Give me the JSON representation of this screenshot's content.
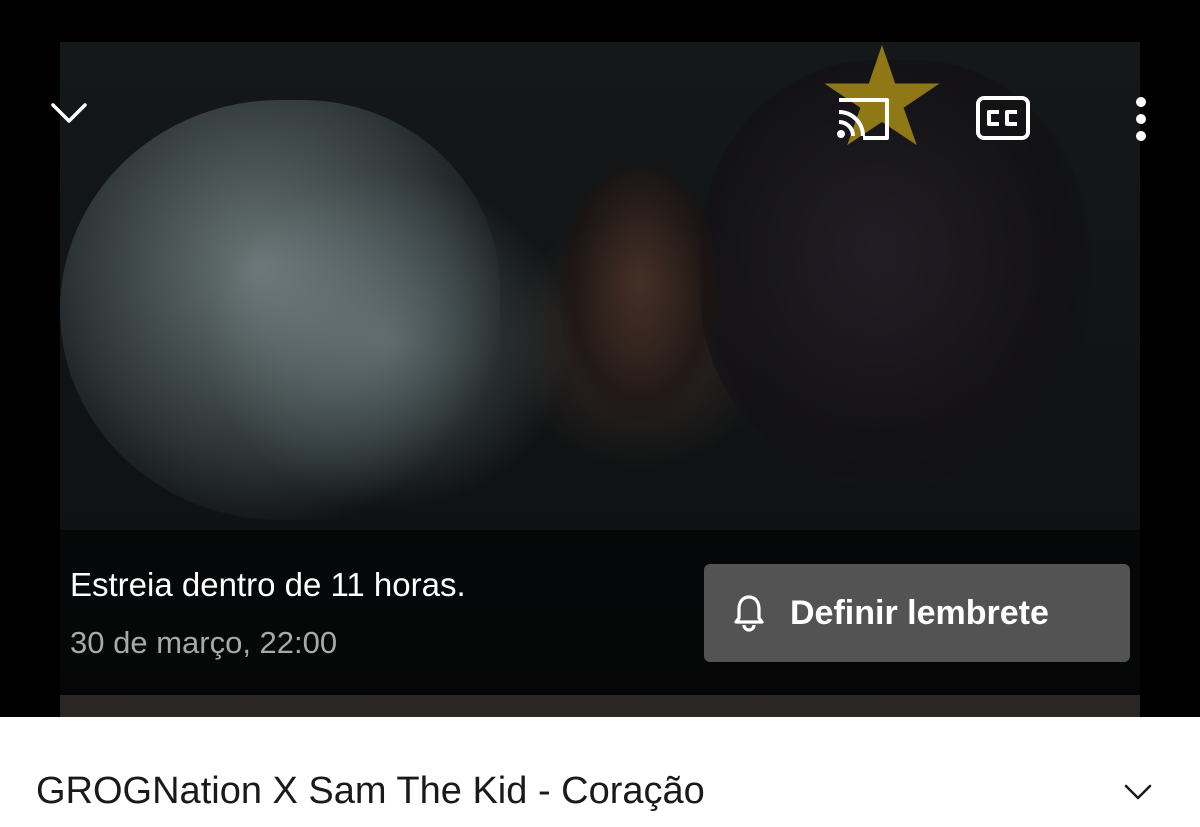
{
  "player": {
    "icons": {
      "minimize": "chevron-down-icon",
      "cast": "cast-icon",
      "captions": "closed-captions-icon",
      "more": "more-vertical-icon"
    },
    "premiere": {
      "status": "Estreia dentro de 11 horas.",
      "date": "30 de março, 22:00",
      "reminder_label": "Definir lembrete",
      "reminder_icon": "bell-icon"
    }
  },
  "video": {
    "title": "GROGNation X Sam The Kid - Coração",
    "expand_icon": "chevron-down-icon"
  },
  "colors": {
    "player_bg": "#000000",
    "star_logo": "#b89a16",
    "reminder_button_bg": "#6e6e6e",
    "date_text": "#a9a9a9"
  }
}
